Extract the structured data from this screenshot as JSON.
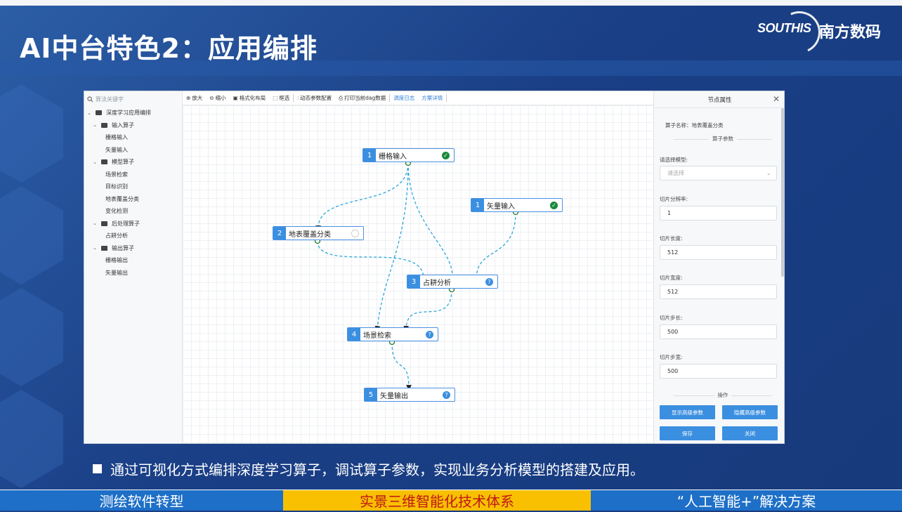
{
  "slide": {
    "title": "AI中台特色2：应用编排",
    "logo_en": "SOUTHIS",
    "logo_cn": "南方数码",
    "bullet": "通过可视化方式编排深度学习算子，调试算子参数，实现业务分析模型的搭建及应用。",
    "footer": [
      "测绘软件转型",
      "实景三维智能化技术体系",
      "“人工智能+”解决方案"
    ],
    "colors": {
      "footer_highlight": "#f8c000",
      "footer_highlight_text": "#c0161a",
      "accent": "#1d6fc7"
    }
  },
  "app": {
    "search_placeholder": "算法关键字",
    "tree": [
      {
        "label": "深度学习应用编排",
        "level": 0,
        "folder": true
      },
      {
        "label": "输入算子",
        "level": 1,
        "folder": true
      },
      {
        "label": "栅格输入",
        "level": 2,
        "folder": false
      },
      {
        "label": "矢量输入",
        "level": 2,
        "folder": false
      },
      {
        "label": "模型算子",
        "level": 1,
        "folder": true
      },
      {
        "label": "场景检索",
        "level": 2,
        "folder": false
      },
      {
        "label": "目标识别",
        "level": 2,
        "folder": false
      },
      {
        "label": "地表覆盖分类",
        "level": 2,
        "folder": false
      },
      {
        "label": "变化检测",
        "level": 2,
        "folder": false
      },
      {
        "label": "后处理算子",
        "level": 1,
        "folder": true
      },
      {
        "label": "占耕分析",
        "level": 2,
        "folder": false
      },
      {
        "label": "输出算子",
        "level": 1,
        "folder": true
      },
      {
        "label": "栅格输出",
        "level": 2,
        "folder": false
      },
      {
        "label": "矢量输出",
        "level": 2,
        "folder": false
      }
    ],
    "toolbar": {
      "zoom_in": "放大",
      "zoom_out": "缩小",
      "format_layout": "格式化布局",
      "box_select": "框选",
      "dynamic_params": "动态参数配置",
      "print_dag": "打印当前dag数据",
      "schedule_log": "调度日志",
      "plan_detail": "方案详情"
    },
    "nodes": {
      "raster_input": {
        "num": "1",
        "label": "栅格输入",
        "status": "check-circle-icon"
      },
      "vector_input": {
        "num": "1",
        "label": "矢量输入",
        "status": "check-circle-icon"
      },
      "land_cover": {
        "num": "2",
        "label": "地表覆盖分类",
        "status": "spinner-icon"
      },
      "occupation": {
        "num": "3",
        "label": "占耕分析",
        "status": "question-icon"
      },
      "scene_search": {
        "num": "4",
        "label": "场景检索",
        "status": "question-icon"
      },
      "vector_output": {
        "num": "5",
        "label": "矢量输出",
        "status": "question-icon"
      }
    },
    "panel": {
      "title": "节点属性",
      "operator_name_label": "算子名称：",
      "operator_name_value": "地表覆盖分类",
      "params_divider": "算子参数",
      "model_label": "请选择模型:",
      "model_placeholder": "请选择",
      "resolution_label": "切片分辨率:",
      "resolution_value": "1",
      "tile_length_label": "切片长度:",
      "tile_length_value": "512",
      "tile_width_label": "切片宽度:",
      "tile_width_value": "512",
      "step_length_label": "切片步长:",
      "step_length_value": "500",
      "step_width_label": "切片步宽:",
      "step_width_value": "500",
      "ops_divider": "操作",
      "show_advanced": "显示高级参数",
      "hide_advanced": "隐藏高级参数",
      "save": "保存",
      "close": "关闭"
    }
  }
}
